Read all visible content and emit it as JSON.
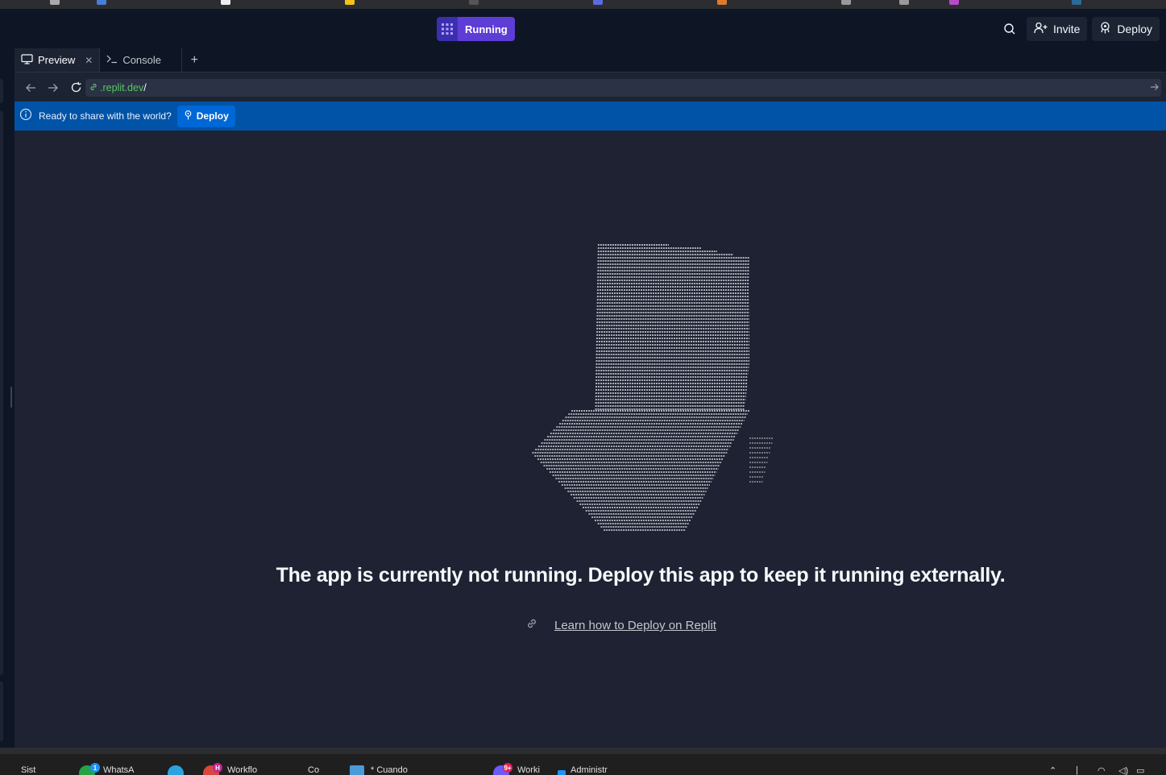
{
  "topbar": {
    "run_label": "Running",
    "invite_label": "Invite",
    "deploy_label": "Deploy"
  },
  "pane": {
    "tabs": [
      {
        "label": "Preview",
        "icon": "monitor-icon",
        "closable": true
      },
      {
        "label": "Console",
        "icon": "terminal-icon",
        "closable": false
      }
    ],
    "add_tab_label": "+"
  },
  "urlbar": {
    "host": ".replit.dev",
    "path": "/"
  },
  "banner": {
    "message": "Ready to share with the world?",
    "button_label": "Deploy"
  },
  "content": {
    "headline": "The app is currently not running. Deploy this app to keep it running externally.",
    "link_label": "Learn how to Deploy on Replit"
  },
  "taskbar": {
    "items": [
      "Sist",
      "WhatsA",
      "Workflo",
      "Co",
      "* Cuando",
      "Worki",
      "Administr"
    ],
    "badges": [
      "1",
      "H",
      "9+"
    ]
  },
  "colors": {
    "run_button": "#5e3dd6",
    "banner": "#0053a6",
    "url_host": "#58c760",
    "background": "#1e2232"
  }
}
